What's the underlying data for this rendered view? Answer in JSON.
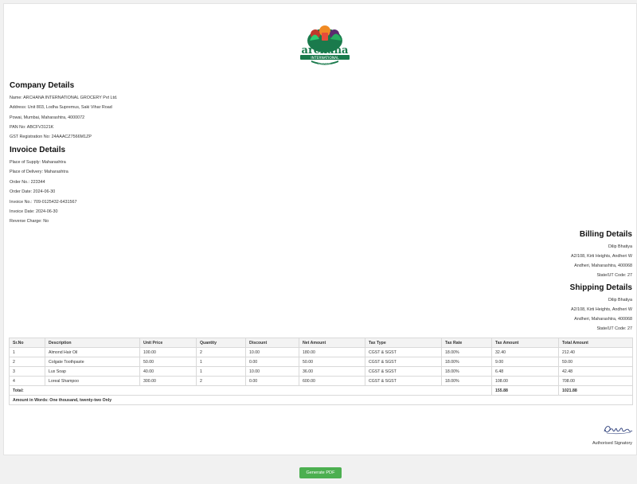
{
  "company": {
    "heading": "Company Details",
    "lines": [
      "Name: ARCHANA INTERNATIONAL GROCERY Pvt Ltd.",
      "Address: Unit 803, Lodha Supremus, Saki Vihar Road",
      "Powai, Mumbai, Maharashtra, 4000072",
      "PAN No: ABCFV3121K",
      "GST Registration No: 24AAACZ7566M1ZP"
    ]
  },
  "invoice": {
    "heading": "Invoice Details",
    "lines": [
      "Place of Supply: Maharashtra",
      "Place of Delivery: Maharashtra",
      "Order No.: 223344",
      "Order Date: 2024-06-30",
      "Invoice No.: 709-0125432-6431567",
      "Invoice Date: 2024-06-30",
      "Reverse Charge: No"
    ]
  },
  "billing": {
    "heading": "Billing Details",
    "lines": [
      "Dilip Bhatiya",
      "A2/108, Kirti Heights, Andheri W",
      "Andheri, Maharashtra, 400068",
      "State/UT Code: 27"
    ]
  },
  "shipping": {
    "heading": "Shipping Details",
    "lines": [
      "Dilip Bhatiya",
      "A2/108, Kirti Heights, Andheri W",
      "Andheri, Maharashtra, 400068",
      "State/UT Code: 27"
    ]
  },
  "table": {
    "headers": [
      "Sr.No",
      "Description",
      "Unit Price",
      "Quantity",
      "Discount",
      "Net Amount",
      "Tax Type",
      "Tax Rate",
      "Tax Amount",
      "Total Amount"
    ],
    "rows": [
      [
        "1",
        "Almond Hair Oil",
        "100.00",
        "2",
        "10.00",
        "180.00",
        "CGST & SGST",
        "18.00%",
        "32.40",
        "212.40"
      ],
      [
        "2",
        "Colgate Toothpaste",
        "50.00",
        "1",
        "0.00",
        "50.00",
        "CGST & SGST",
        "18.00%",
        "9.00",
        "59.00"
      ],
      [
        "3",
        "Lux Soap",
        "40.00",
        "1",
        "10.00",
        "36.00",
        "CGST & SGST",
        "18.00%",
        "6.48",
        "42.48"
      ],
      [
        "4",
        "Loreal Shampoo",
        "300.00",
        "2",
        "0.00",
        "600.00",
        "CGST & SGST",
        "18.00%",
        "108.00",
        "708.00"
      ]
    ],
    "total_label": "Total:",
    "total_tax": "155.88",
    "total_amount": "1021.88",
    "amount_words": "Amount in Words: One thousand, twenty-two Only"
  },
  "logo": {
    "text": "archana",
    "subtext": "INTERNATIONAL",
    "subtext2": "GROCERY",
    "colors": {
      "green": "#1a7a4c",
      "orange": "#f08a24",
      "red": "#c0392b",
      "purple": "#5b2c6f"
    }
  },
  "signature": {
    "text": "Dhinde",
    "label": "Authorised Signatory"
  },
  "button": {
    "label": "Generate PDF",
    "color": "#4caf50"
  }
}
